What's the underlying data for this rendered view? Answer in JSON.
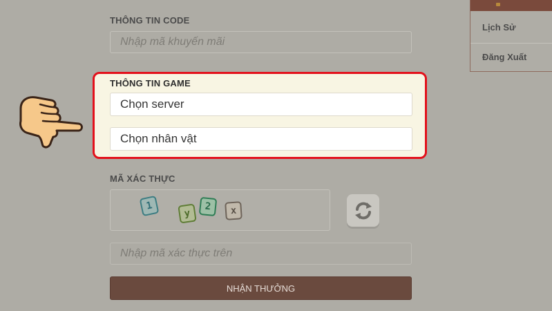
{
  "code_section": {
    "label": "THÔNG TIN CODE",
    "promo_placeholder": "Nhập mã khuyến mãi"
  },
  "menu": {
    "items": [
      {
        "label": "Lịch Sử"
      },
      {
        "label": "Đăng Xuất"
      }
    ]
  },
  "game_section": {
    "label": "THÔNG TIN GAME",
    "server_value": "Chọn server",
    "character_value": "Chọn nhân vật"
  },
  "captcha_section": {
    "label": "MÃ XÁC THỰC",
    "characters": [
      "1",
      "y",
      "2",
      "x"
    ],
    "input_placeholder": "Nhập mã xác thực trên"
  },
  "submit_label": "NHẬN THƯỞNG",
  "colors": {
    "highlight_border": "#e3101b",
    "highlight_bg": "#f8f5e3",
    "submit_bg": "#6a4a3e",
    "page_bg": "#aeaca5"
  },
  "icons": {
    "pointer": "pointing-hand-icon",
    "refresh": "refresh-icon"
  }
}
